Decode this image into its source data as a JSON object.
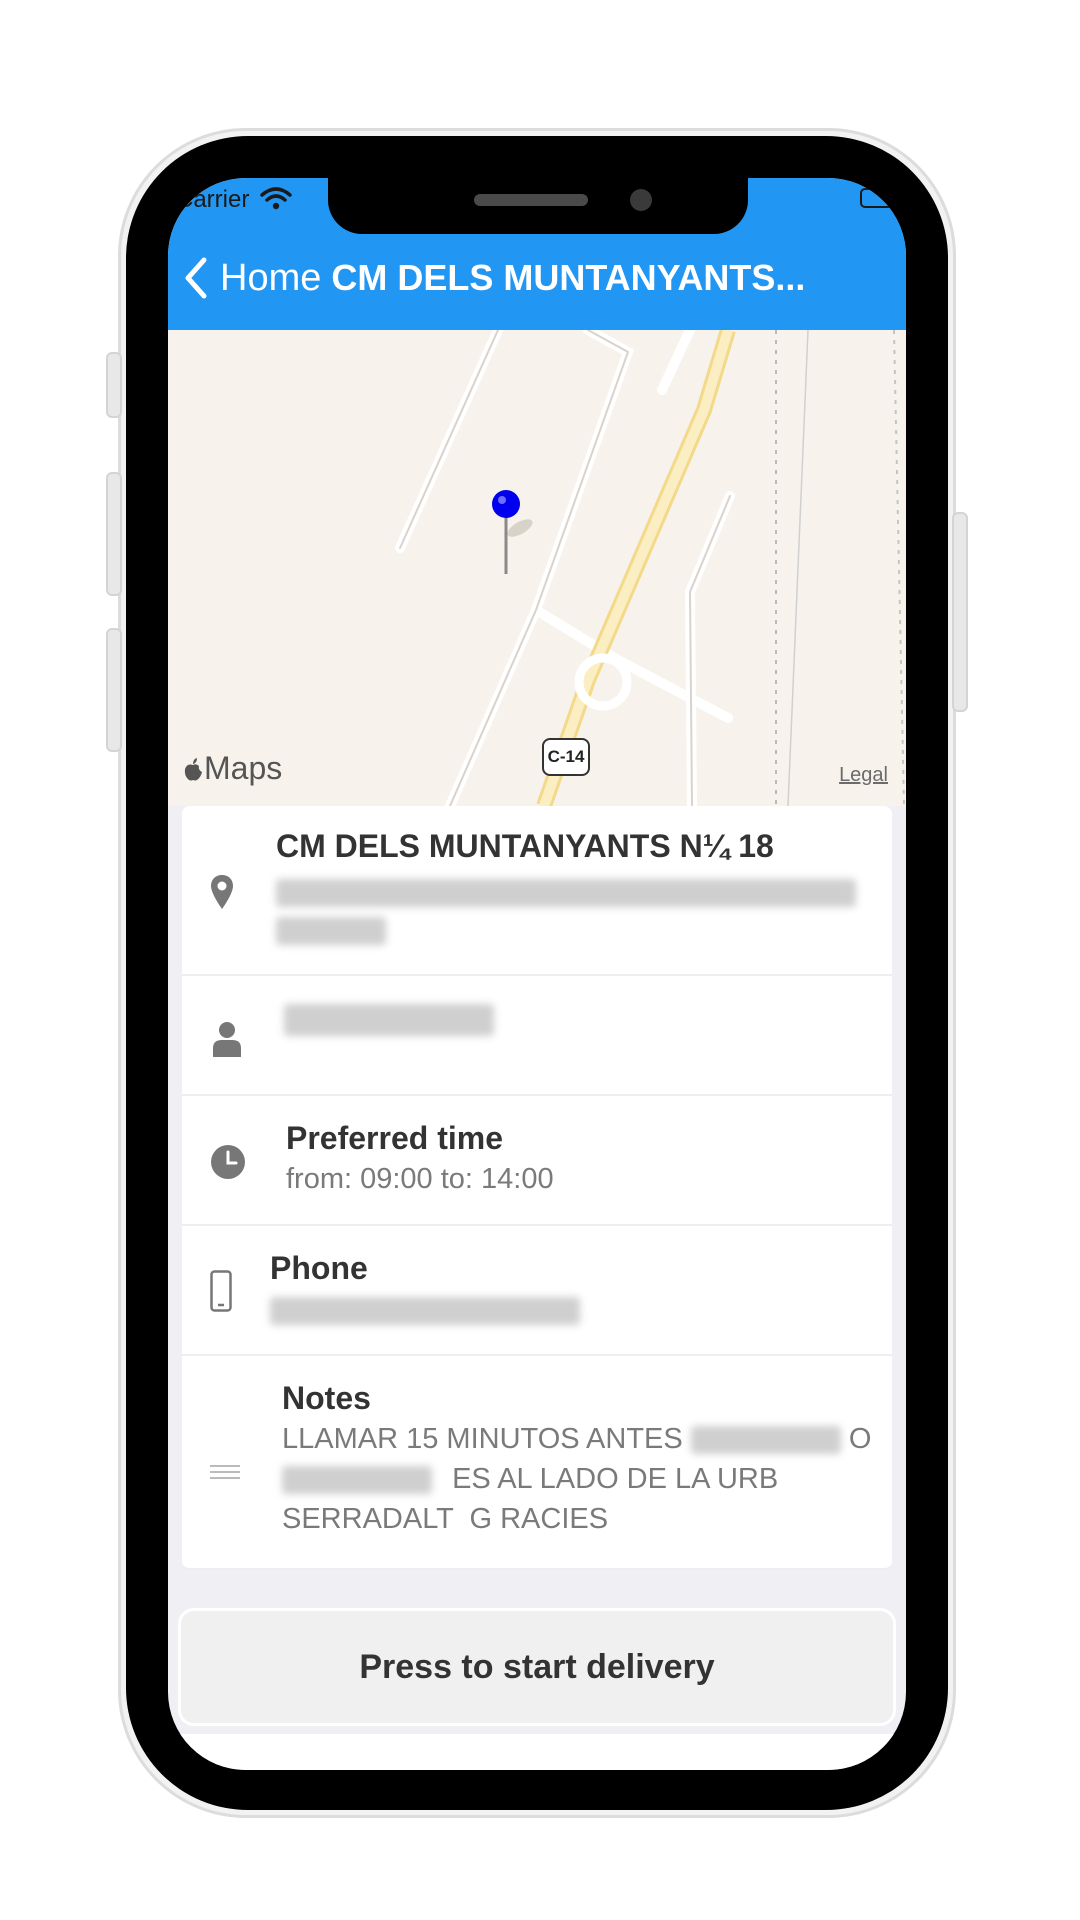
{
  "status_bar": {
    "carrier": "Carrier"
  },
  "nav": {
    "back_label": "Home",
    "title": "CM DELS MUNTANYANTS..."
  },
  "map": {
    "provider_label": "Maps",
    "legal_label": "Legal",
    "road_badge": "C-14"
  },
  "address": {
    "title": "CM DELS MUNTANYANTS N¼ 18",
    "icon": "location-pin-icon"
  },
  "contact": {
    "icon": "person-icon"
  },
  "preferred_time": {
    "title": "Preferred time",
    "value": "from: 09:00 to: 14:00",
    "icon": "clock-icon"
  },
  "phone": {
    "title": "Phone",
    "icon": "mobile-phone-icon"
  },
  "notes": {
    "title": "Notes",
    "line1": "LLAMAR 15 MINUTOS ANTES",
    "line1_end": "O",
    "line2": "ES AL LADO DE LA URB",
    "line3": "SERRADALT  G RACIES",
    "icon": "lines-icon"
  },
  "actions": {
    "start_delivery_label": "Press to start delivery"
  },
  "colors": {
    "header": "#2196f3",
    "pin": "#0000ee"
  }
}
